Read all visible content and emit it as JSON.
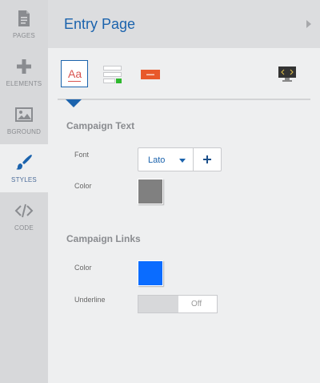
{
  "sidebar": {
    "items": [
      {
        "label": "PAGES",
        "icon": "page-icon"
      },
      {
        "label": "ELEMENTS",
        "icon": "plus-icon"
      },
      {
        "label": "BGROUND",
        "icon": "image-icon"
      },
      {
        "label": "STYLES",
        "icon": "brush-icon",
        "active": true
      },
      {
        "label": "CODE",
        "icon": "code-icon"
      }
    ]
  },
  "header": {
    "title": "Entry Page"
  },
  "toolbar": {
    "text_tool_glyph": "Aa"
  },
  "campaign_text": {
    "title": "Campaign Text",
    "font_label": "Font",
    "font_value": "Lato",
    "color_label": "Color",
    "color_value": "#808080"
  },
  "campaign_links": {
    "title": "Campaign Links",
    "color_label": "Color",
    "color_value": "#0a6cff",
    "underline_label": "Underline",
    "underline_value": "Off"
  },
  "colors": {
    "accent": "#1b63ad",
    "sidebar_bg": "#d7d8da",
    "button_orange": "#e8582a",
    "indicator_green": "#2eb82e"
  }
}
